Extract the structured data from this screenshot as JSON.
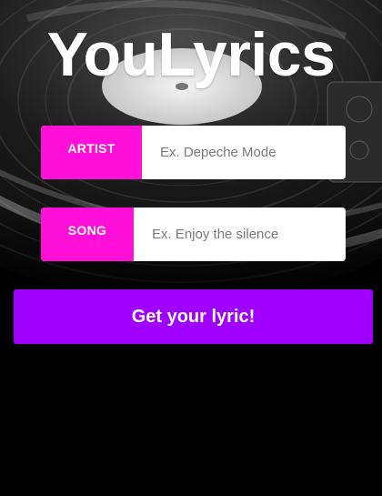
{
  "app": {
    "title": "YouLyrics"
  },
  "form": {
    "artist": {
      "label": "ARTIST",
      "placeholder": "Ex. Depeche Mode",
      "value": ""
    },
    "song": {
      "label": "SONG",
      "placeholder": "Ex. Enjoy the silence",
      "value": ""
    },
    "submit_label": "Get your lyric!"
  },
  "colors": {
    "background": "#000000",
    "label_bg": "#ff10d8",
    "button_bg": "#a000ff",
    "text": "#ffffff"
  },
  "background_image": {
    "subject": "vinyl-record-turntable",
    "style": "grayscale"
  }
}
